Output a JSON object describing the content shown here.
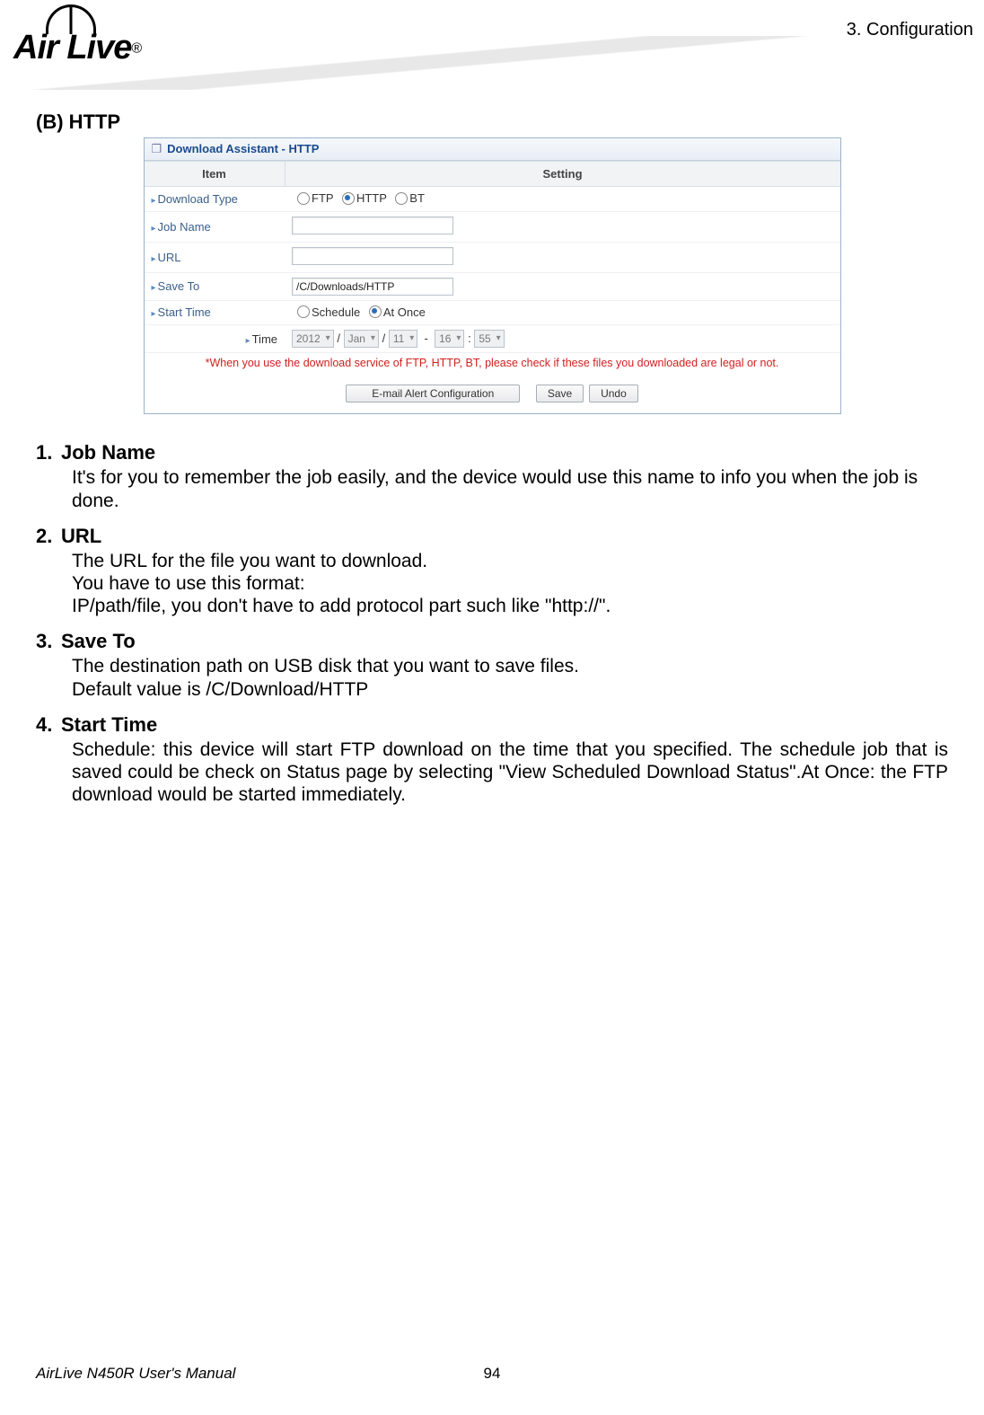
{
  "header": {
    "chapter": "3. Configuration"
  },
  "logo": {
    "text": "Air Live",
    "mark": "®"
  },
  "section": {
    "label": "(B)  HTTP"
  },
  "panel": {
    "title": "Download Assistant - HTTP",
    "col_item": "Item",
    "col_setting": "Setting",
    "rows": {
      "download_type": {
        "label": "Download Type",
        "opt_ftp": "FTP",
        "opt_http": "HTTP",
        "opt_bt": "BT",
        "selected": "HTTP"
      },
      "job_name": {
        "label": "Job Name",
        "value": ""
      },
      "url": {
        "label": "URL",
        "value": ""
      },
      "save_to": {
        "label": "Save To",
        "value": "/C/Downloads/HTTP"
      },
      "start_time": {
        "label": "Start Time",
        "opt_schedule": "Schedule",
        "opt_atonce": "At Once",
        "selected": "At Once"
      },
      "time": {
        "label": "Time",
        "year": "2012",
        "month": "Jan",
        "day": "11",
        "hour": "16",
        "minute": "55",
        "sep1": "/",
        "sep2": "/",
        "sep3": "-",
        "sep4": ":"
      }
    },
    "warning": "*When you use the download service of FTP, HTTP, BT, please check if these files you downloaded are legal or not.",
    "buttons": {
      "email": "E-mail Alert Configuration",
      "save": "Save",
      "undo": "Undo"
    }
  },
  "doc": {
    "items": [
      {
        "num": "1.",
        "title": "Job Name",
        "body": "It's for you to remember the job easily, and the device would use this name to info you when the job is done."
      },
      {
        "num": "2.",
        "title": "URL",
        "body": "The URL for the file you want to download.\nYou have to use this format:\nIP/path/file, you don't have to add protocol part such like \"http://\"."
      },
      {
        "num": "3.",
        "title": "Save To",
        "body": "The destination path on USB disk that you want to save files.\nDefault value is /C/Download/HTTP"
      },
      {
        "num": "4.",
        "title": "Start Time",
        "body": "Schedule: this device will start FTP download on the time that you specified. The schedule job that is saved could be check on Status page by selecting \"View Scheduled Download Status\".At Once: the FTP download would be started immediately."
      }
    ]
  },
  "footer": {
    "left": "AirLive N450R User's Manual",
    "page": "94"
  }
}
